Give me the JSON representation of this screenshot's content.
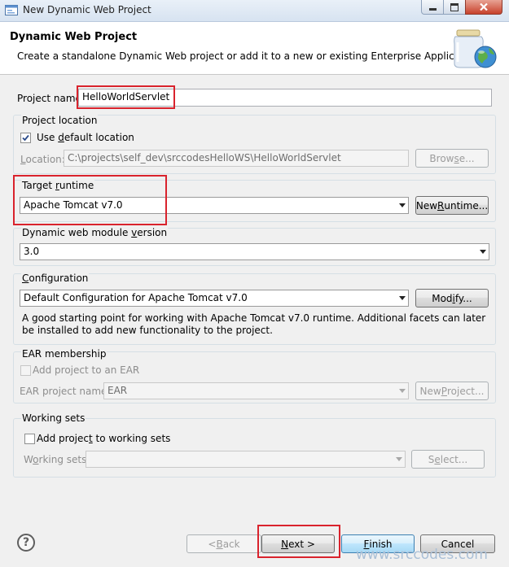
{
  "window": {
    "title": "New Dynamic Web Project"
  },
  "header": {
    "title": "Dynamic Web Project",
    "description": "Create a standalone Dynamic Web project or add it to a new or existing Enterprise Application."
  },
  "project_name": {
    "label_pre": "Project nam",
    "label_post": "e:",
    "value": "HelloWorldServlet"
  },
  "project_location": {
    "group_label": "Project location",
    "use_default_pre": "Use ",
    "use_default_mn": "d",
    "use_default_post": "efault location",
    "use_default_checked": true,
    "location_mn": "L",
    "location_post": "ocation:",
    "location_value": "C:\\projects\\self_dev\\srccodesHelloWS\\HelloWorldServlet",
    "browse_pre": "Brow",
    "browse_mn": "s",
    "browse_post": "e..."
  },
  "target_runtime": {
    "label_pre": "Target ",
    "label_mn": "r",
    "label_post": "untime",
    "selected": "Apache Tomcat v7.0",
    "new_runtime_pre": "New ",
    "new_runtime_mn": "R",
    "new_runtime_post": "untime..."
  },
  "module_version": {
    "label_pre": "Dynamic web module ",
    "label_mn": "v",
    "label_post": "ersion",
    "selected": "3.0"
  },
  "configuration": {
    "label_mn": "C",
    "label_post": "onfiguration",
    "selected": "Default Configuration for Apache Tomcat v7.0",
    "modify_pre": "Mod",
    "modify_mn": "i",
    "modify_post": "fy...",
    "description": "A good starting point for working with Apache Tomcat v7.0 runtime. Additional facets can later be installed to add new functionality to the project."
  },
  "ear": {
    "group_label": "EAR membership",
    "add_label": "Add project to an EAR",
    "add_checked": false,
    "project_name_label": "EAR project name:",
    "project_name_value": "EAR",
    "new_project_pre": "New ",
    "new_project_mn": "P",
    "new_project_post": "roject..."
  },
  "working_sets": {
    "group_label": "Working sets",
    "add_pre": "Add projec",
    "add_mn": "t",
    "add_post": " to working sets",
    "add_checked": false,
    "sets_pre": "W",
    "sets_mn": "o",
    "sets_post": "rking sets:",
    "sets_value": "",
    "select_pre": "S",
    "select_mn": "e",
    "select_post": "lect..."
  },
  "footer": {
    "help_glyph": "?",
    "back_pre": "< ",
    "back_mn": "B",
    "back_post": "ack",
    "next_mn": "N",
    "next_post": "ext >",
    "finish_mn": "F",
    "finish_post": "inish",
    "cancel": "Cancel"
  },
  "watermark": "www.srccodes.com",
  "icons": [
    "app-window-icon",
    "minimize-icon",
    "maximize-icon",
    "close-icon",
    "jar-globe-icon",
    "help-icon",
    "check-icon",
    "dropdown-arrow-icon"
  ],
  "colors": {
    "highlight_box": "#d9232d",
    "default_button": "#3c7fb1"
  }
}
